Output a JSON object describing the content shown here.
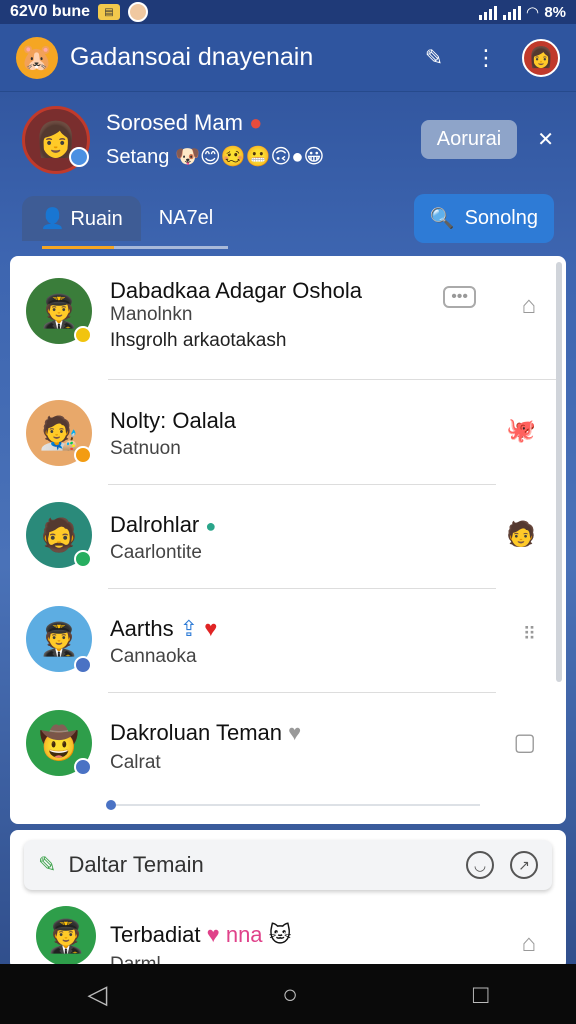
{
  "status_bar": {
    "left_text": "62V0 bune",
    "right_text": "8%"
  },
  "header": {
    "title": "Gadansoai dnayenain",
    "icons": [
      "share-icon",
      "more-vert-icon",
      "avatar"
    ]
  },
  "profile": {
    "name": "Sorosed Mam",
    "status": "Setang",
    "status_emojis": "🐶😊🥴😬🙃●😀",
    "action_label": "Aorurai"
  },
  "tabs": {
    "active_label": "Ruain",
    "second_label": "NA7el",
    "search_label": "Sonolng"
  },
  "friends": [
    {
      "name": "Dabadkaa Adagar Osholа",
      "sub": "Manolnkn",
      "sub2": "Ihsgrolh arkaotakash",
      "avatar_color": "#3a7d3a",
      "emoji": "🧑‍✈️",
      "badge_color": "#f1c40f",
      "right_icon": "home-icon"
    },
    {
      "name": "Nolty: Oalala",
      "sub": "Satnuon",
      "avatar_color": "#e8a86a",
      "emoji": "🧑‍🎨",
      "badge_color": "#f39c12",
      "right_icon": "octopus-icon"
    },
    {
      "name": "Dalrohlar",
      "sub": "Caarlontite",
      "avatar_color": "#2a8a7a",
      "emoji": "🧔",
      "badge_color": "#27ae60",
      "right_icon": "person-icon"
    },
    {
      "name": "Aarths",
      "sub": "Cannaoka",
      "avatar_color": "#5dade2",
      "emoji": "🧑‍✈️",
      "badge_color": "#4a72c4",
      "right_icon": "dots-grid-icon"
    },
    {
      "name": "Dakroluan Teman",
      "sub": "Calrat",
      "avatar_color": "#2e9e4a",
      "emoji": "🤠",
      "badge_color": "#4a72c4",
      "right_icon": "note-icon"
    }
  ],
  "list_section": {
    "title": "Daltar Temain",
    "first_name": "Terbadiat",
    "first_tag": "nna",
    "first_sub": "Darml"
  },
  "colors": {
    "app_bar": "#2f559f",
    "accent": "#2e7bd6",
    "tab_active": "#3e5c95"
  }
}
